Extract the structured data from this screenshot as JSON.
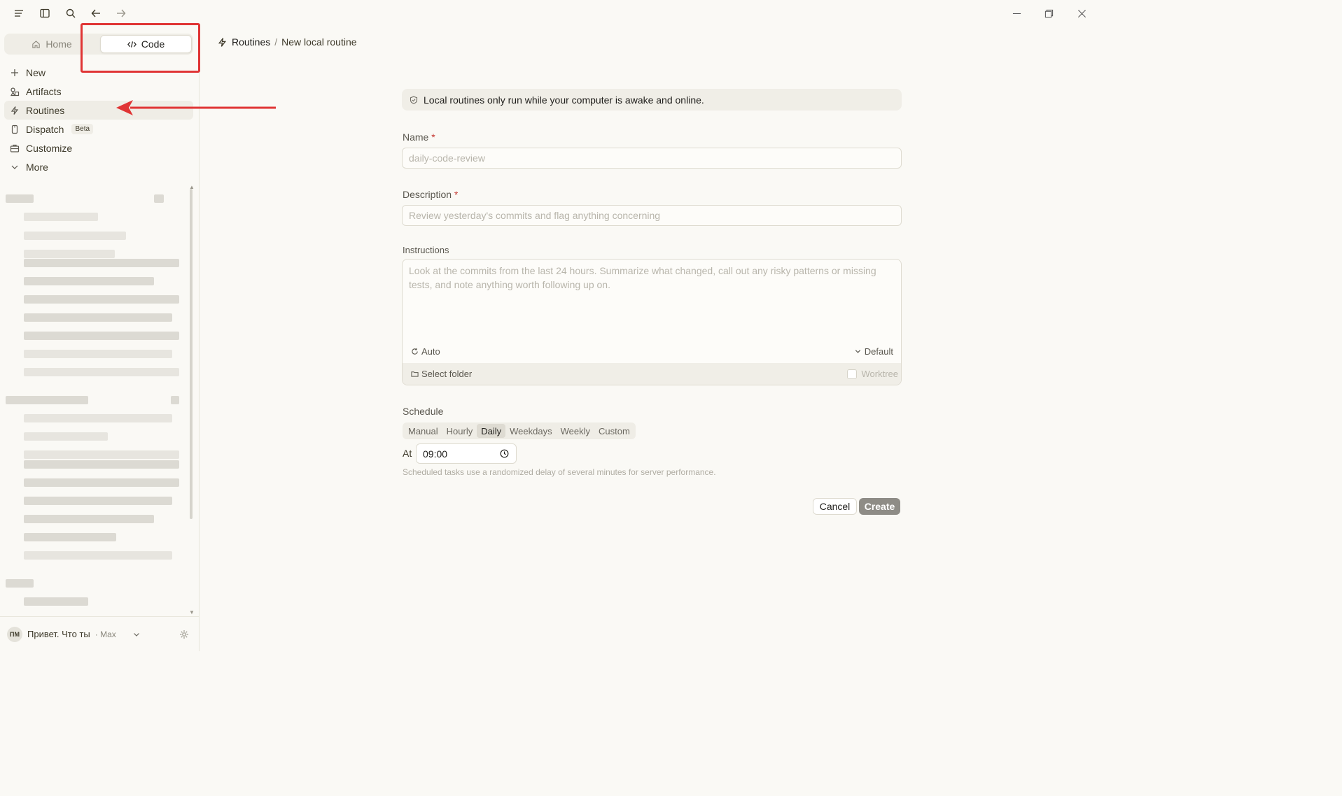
{
  "titlebar": {
    "menu_icon": "hamburger-menu-icon",
    "sidebar_icon": "sidebar-toggle-icon",
    "search_icon": "search-icon",
    "back_icon": "arrow-left-icon",
    "forward_icon": "arrow-right-icon"
  },
  "sidebar": {
    "mode_toggle": {
      "home_label": "Home",
      "code_label": "Code",
      "selected": "Code"
    },
    "nav": [
      {
        "label": "New",
        "icon": "plus-icon"
      },
      {
        "label": "Artifacts",
        "icon": "shapes-icon"
      },
      {
        "label": "Routines",
        "icon": "lightning-icon",
        "active": true
      },
      {
        "label": "Dispatch",
        "icon": "phone-icon",
        "badge": "Beta"
      },
      {
        "label": "Customize",
        "icon": "briefcase-icon"
      },
      {
        "label": "More",
        "icon": "chevron-down-icon"
      }
    ],
    "user": {
      "initials": "ПМ",
      "name": "Привет. Что ты",
      "plan": "· Max"
    }
  },
  "breadcrumb": {
    "parent": "Routines",
    "separator": "/",
    "current": "New local routine"
  },
  "form": {
    "notice": "Local routines only run while your computer is awake and online.",
    "name": {
      "label": "Name",
      "required_mark": "*",
      "placeholder": "daily-code-review",
      "value": ""
    },
    "description": {
      "label": "Description",
      "required_mark": "*",
      "placeholder": "Review yesterday's commits and flag anything concerning",
      "value": ""
    },
    "instructions": {
      "label": "Instructions",
      "placeholder": "Look at the commits from the last 24 hours. Summarize what changed, call out any risky patterns or missing tests, and note anything worth following up on.",
      "mode_label": "Auto",
      "model_label": "Default",
      "folder_label": "Select folder",
      "worktree_label": "Worktree",
      "worktree_checked": false
    },
    "schedule": {
      "label": "Schedule",
      "options": [
        "Manual",
        "Hourly",
        "Daily",
        "Weekdays",
        "Weekly",
        "Custom"
      ],
      "selected": "Daily",
      "at_label": "At",
      "time": "09:00",
      "hint": "Scheduled tasks use a randomized delay of several minutes for server performance."
    },
    "cancel_label": "Cancel",
    "create_label": "Create"
  },
  "colors": {
    "annotation": "#e03535",
    "background": "#faf9f5",
    "create_button": "#8e8c86",
    "required": "#c4362f"
  }
}
